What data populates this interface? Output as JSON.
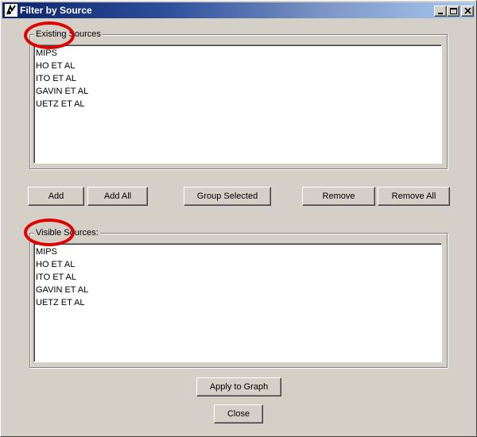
{
  "window": {
    "title": "Filter by Source",
    "controls": {
      "minimize": "minimize-icon",
      "maximize": "maximize-icon",
      "close": "close-icon"
    }
  },
  "existing_sources": {
    "label": "Existing Sources",
    "items": [
      "MIPS",
      "HO ET AL",
      "ITO ET AL",
      "GAVIN ET AL",
      "UETZ ET AL"
    ]
  },
  "actions": {
    "add": "Add",
    "add_all": "Add All",
    "group_selected": "Group Selected",
    "remove": "Remove",
    "remove_all": "Remove All"
  },
  "visible_sources": {
    "label": "Visible Sources:",
    "items": [
      "MIPS",
      "HO ET AL",
      "ITO ET AL",
      "GAVIN ET AL",
      "UETZ ET AL"
    ]
  },
  "footer": {
    "apply": "Apply to Graph",
    "close": "Close"
  },
  "annotation_color": "#e10000"
}
